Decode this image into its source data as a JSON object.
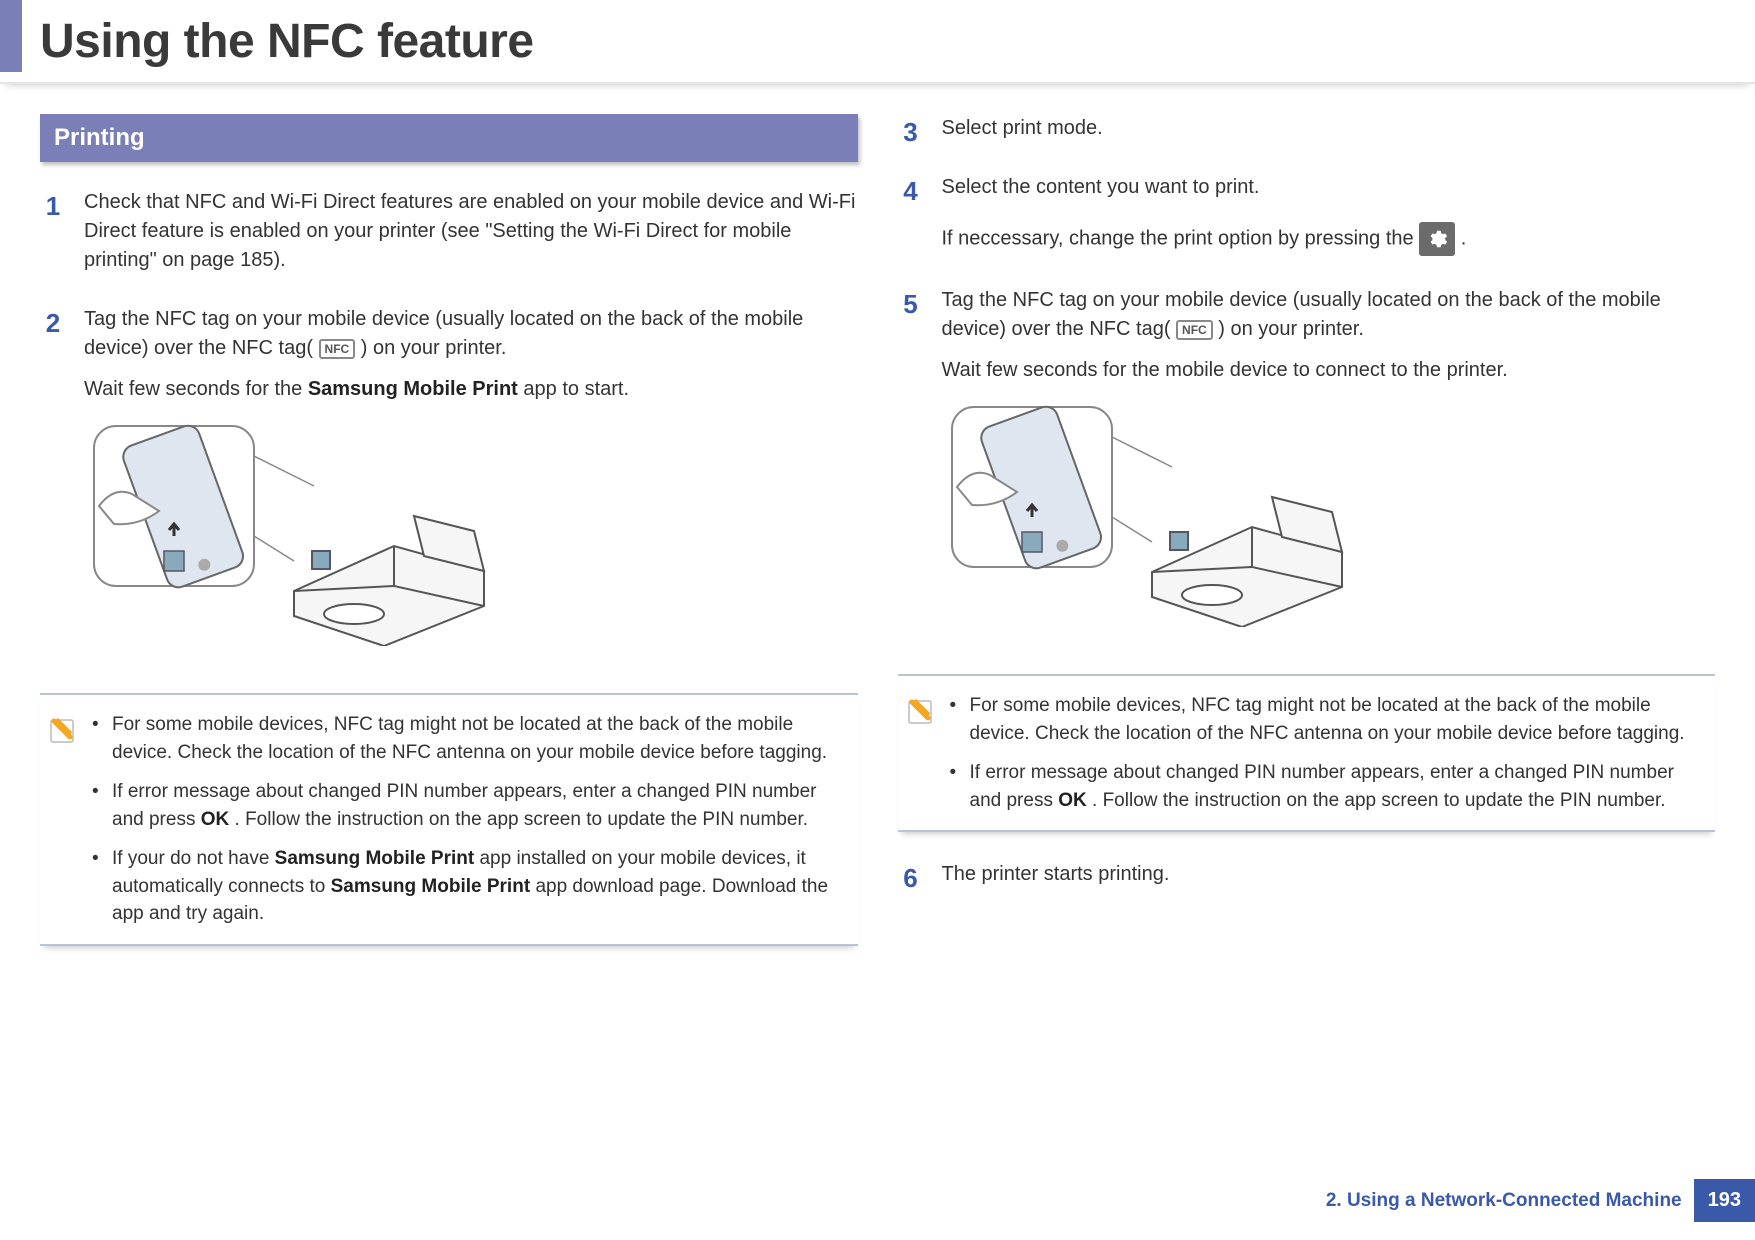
{
  "header": {
    "title": "Using the NFC feature"
  },
  "left": {
    "section_title": "Printing",
    "step1": {
      "num": "1",
      "text": "Check that NFC and Wi-Fi Direct features are enabled on your mobile device  and Wi-Fi Direct feature is enabled on your printer (see \"Setting the Wi-Fi Direct for mobile printing\" on page 185)."
    },
    "step2": {
      "num": "2",
      "p1a": "Tag the NFC tag on your mobile device (usually located on the back of the mobile device) over the NFC tag(",
      "nfc": "NFC",
      "p1b": ") on your printer.",
      "p2a": "Wait few seconds for the ",
      "p2bold": "Samsung Mobile Print",
      "p2b": " app to start."
    },
    "note": {
      "b1": "For some mobile devices, NFC tag might not be located at the back of the mobile device. Check the location of the NFC antenna on your mobile device before tagging.",
      "b2a": "If error message about changed PIN number appears, enter a changed PIN number and press ",
      "b2bold": "OK",
      "b2b": ". Follow the instruction on the app screen to update the PIN number.",
      "b3a": "If your do not have ",
      "b3bold1": "Samsung Mobile Print",
      "b3b": " app installed on your mobile devices, it automatically connects to ",
      "b3bold2": "Samsung Mobile Print",
      "b3c": " app download page. Download the app and try again."
    }
  },
  "right": {
    "step3": {
      "num": "3",
      "text": "Select print mode."
    },
    "step4": {
      "num": "4",
      "p1": "Select the content you want to print.",
      "p2a": "If neccessary, change the print option by pressing the ",
      "p2b": "."
    },
    "step5": {
      "num": "5",
      "p1a": "Tag the NFC tag on your mobile device (usually located on the back of the mobile device) over the NFC tag(",
      "nfc": "NFC",
      "p1b": ") on your printer.",
      "p2": "Wait few seconds for the mobile device to connect to the printer."
    },
    "note": {
      "b1": "For some mobile devices, NFC tag might not be located at the back of the mobile device. Check the location of the NFC antenna on your mobile device before tagging.",
      "b2a": "If error message about changed PIN number appears, enter a changed PIN number and press ",
      "b2bold": "OK",
      "b2b": ". Follow the instruction on the app screen to update the PIN number."
    },
    "step6": {
      "num": "6",
      "text": "The printer starts printing."
    }
  },
  "footer": {
    "chapter": "2.  Using a Network-Connected Machine",
    "page": "193"
  }
}
